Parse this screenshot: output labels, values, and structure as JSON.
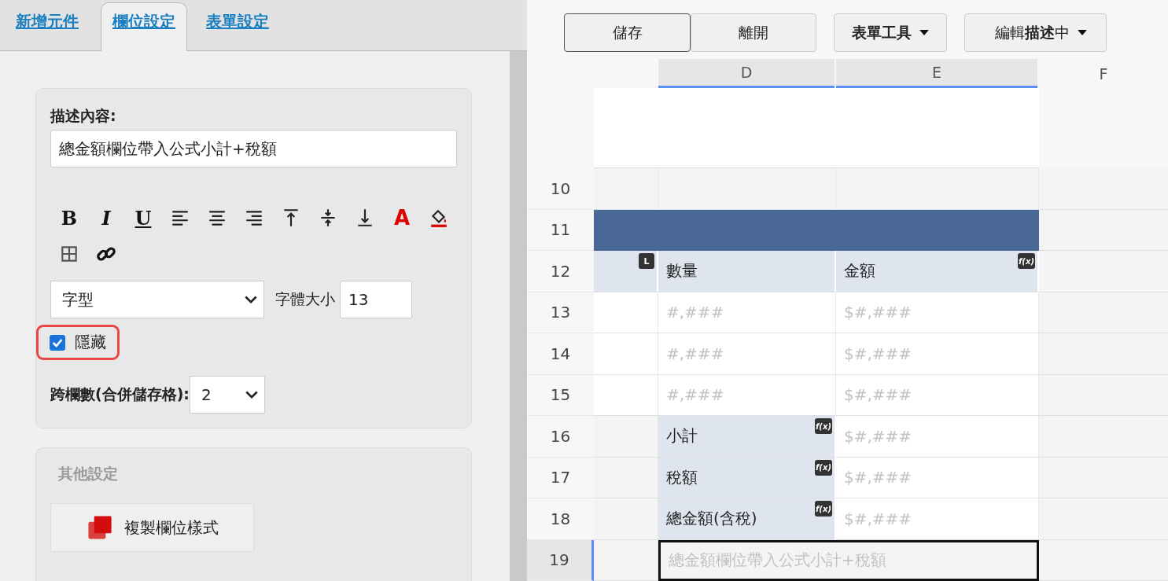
{
  "tabs": [
    {
      "label": "新增元件",
      "selected": false
    },
    {
      "label": "欄位設定",
      "selected": true
    },
    {
      "label": "表單設定",
      "selected": false
    }
  ],
  "description": {
    "label": "描述內容:",
    "value": "總金額欄位帶入公式小計+稅額"
  },
  "toolbar": [
    {
      "kind": "bold",
      "glyph": "B"
    },
    {
      "kind": "italic",
      "glyph": "I"
    },
    {
      "kind": "underline",
      "glyph": "U"
    },
    {
      "kind": "align-left"
    },
    {
      "kind": "align-center"
    },
    {
      "kind": "align-right"
    },
    {
      "kind": "valign-top"
    },
    {
      "kind": "valign-middle"
    },
    {
      "kind": "valign-bottom"
    },
    {
      "kind": "font-color",
      "glyph": "A"
    },
    {
      "kind": "fill-color"
    },
    {
      "kind": "border"
    },
    {
      "kind": "link"
    }
  ],
  "font": {
    "family_value": "字型",
    "size_label": "字體大小",
    "size_value": "13"
  },
  "hidden": {
    "label": "隱藏",
    "checked": true
  },
  "colspan": {
    "label": "跨欄數(合併儲存格):",
    "value": "2"
  },
  "other_settings": {
    "title": "其他設定",
    "button": "複製欄位樣式"
  },
  "actions": [
    {
      "label": "儲存",
      "focused": true
    },
    {
      "label": "離開",
      "focused": false
    }
  ],
  "menus": [
    {
      "label": "表單工具"
    },
    {
      "label": "編輯**描述**中"
    }
  ],
  "columns": [
    {
      "label": "D",
      "highlighted": true
    },
    {
      "label": "E",
      "highlighted": true
    },
    {
      "label": "F",
      "highlighted": false
    }
  ],
  "rows": [
    {
      "number": "10",
      "kind": "blank",
      "selected": false
    },
    {
      "number": "11",
      "kind": "band",
      "selected": false
    },
    {
      "number": "12",
      "kind": "cells",
      "selected": false,
      "cells": [
        {
          "kind": "shaded",
          "badge": "L"
        },
        {
          "kind": "shaded",
          "text": "數量"
        },
        {
          "kind": "shaded",
          "text": "金額",
          "badge": "f(x)"
        }
      ]
    },
    {
      "number": "13",
      "kind": "cells",
      "selected": false,
      "cells": [
        {
          "kind": "plain"
        },
        {
          "kind": "plain",
          "text": "#,###",
          "placeholder": true
        },
        {
          "kind": "plain",
          "text": "$#,###",
          "placeholder": true
        }
      ]
    },
    {
      "number": "14",
      "kind": "cells",
      "selected": false,
      "cells": [
        {
          "kind": "plain"
        },
        {
          "kind": "plain",
          "text": "#,###",
          "placeholder": true
        },
        {
          "kind": "plain",
          "text": "$#,###",
          "placeholder": true
        }
      ]
    },
    {
      "number": "15",
      "kind": "cells",
      "selected": false,
      "cells": [
        {
          "kind": "plain"
        },
        {
          "kind": "plain",
          "text": "#,###",
          "placeholder": true
        },
        {
          "kind": "plain",
          "text": "$#,###",
          "placeholder": true
        }
      ]
    },
    {
      "number": "16",
      "kind": "cells",
      "selected": false,
      "cells": [
        {
          "kind": "empty"
        },
        {
          "kind": "shaded",
          "text": "小計",
          "badge": "f(x)"
        },
        {
          "kind": "plain",
          "text": "$#,###",
          "placeholder": true
        }
      ]
    },
    {
      "number": "17",
      "kind": "cells",
      "selected": false,
      "cells": [
        {
          "kind": "empty"
        },
        {
          "kind": "shaded",
          "text": "稅額",
          "badge": "f(x)"
        },
        {
          "kind": "plain",
          "text": "$#,###",
          "placeholder": true
        }
      ]
    },
    {
      "number": "18",
      "kind": "cells",
      "selected": false,
      "cells": [
        {
          "kind": "empty"
        },
        {
          "kind": "shaded",
          "text": "總金額(含稅)",
          "badge": "f(x)"
        },
        {
          "kind": "plain",
          "text": "$#,###",
          "placeholder": true
        }
      ]
    },
    {
      "number": "19",
      "kind": "merged",
      "selected": true,
      "text": "總金額欄位帶入公式小計+稅額",
      "placeholder": true
    }
  ]
}
